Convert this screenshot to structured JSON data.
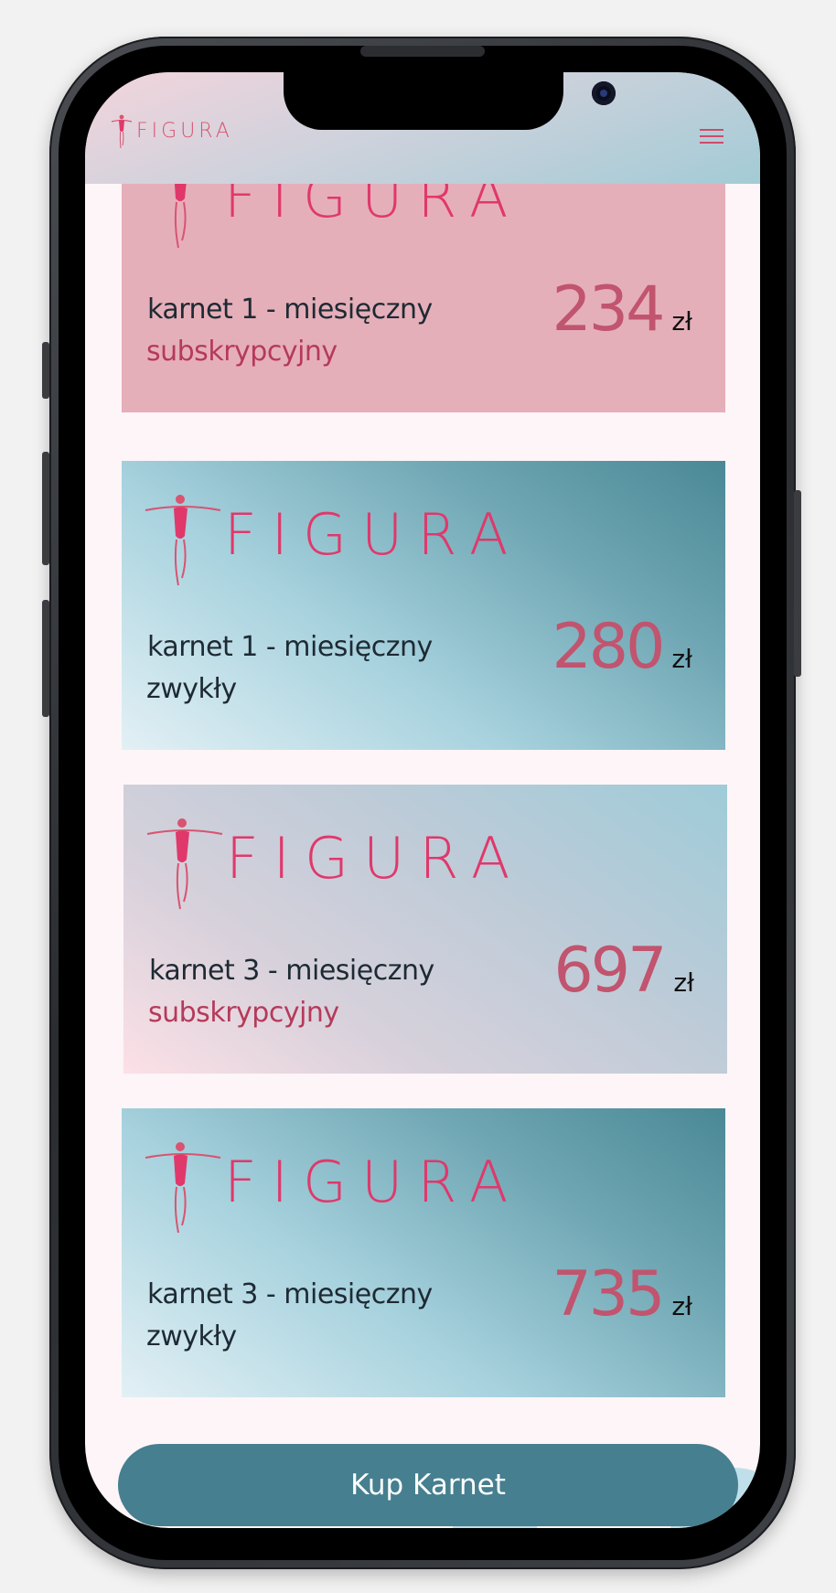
{
  "header": {
    "brand": "FIGURA",
    "menu_icon": "hamburger-menu-icon"
  },
  "cards": [
    {
      "brand": "FIGURA",
      "title": "karnet 1 - miesięczny",
      "subtitle": "subskrypcyjny",
      "price": "234",
      "currency": "zł",
      "style": "pink"
    },
    {
      "brand": "FIGURA",
      "title": "karnet 1 - miesięczny",
      "subtitle": "zwykły",
      "price": "280",
      "currency": "zł",
      "style": "teal"
    },
    {
      "brand": "FIGURA",
      "title": "karnet 3 - miesięczny",
      "subtitle": "subskrypcyjny",
      "price": "697",
      "currency": "zł",
      "style": "lilac"
    },
    {
      "brand": "FIGURA",
      "title": "karnet 3 - miesięczny",
      "subtitle": "zwykły",
      "price": "735",
      "currency": "zł",
      "style": "teal"
    }
  ],
  "buy_button": {
    "label": "Kup Karnet"
  },
  "colors": {
    "brand_pink": "#e0386b",
    "price_pink": "#c1546e",
    "button_teal": "#467f8f",
    "background": "#fdf5f7"
  }
}
